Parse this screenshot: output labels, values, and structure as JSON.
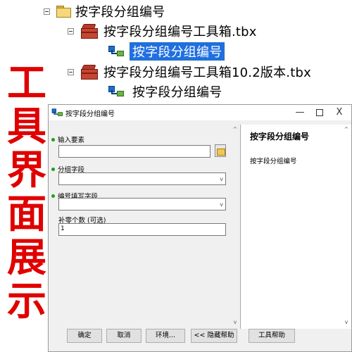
{
  "tree": {
    "folder_label": "按字段分组编号",
    "toolbox1_label": "按字段分组编号工具箱.tbx",
    "tool1_label": "按字段分组编号",
    "toolbox2_label": "按字段分组编号工具箱10.2版本.tbx",
    "tool2_label": "按字段分组编号"
  },
  "banner": {
    "text": "工具界面展示",
    "color": "#e00000"
  },
  "dialog": {
    "title": "按字段分组编号",
    "controls": {
      "minimize": "—",
      "close": "X"
    },
    "params": {
      "input_features_label": "输入要素",
      "group_field_label": "分组字段",
      "number_field_label": "编号填写字段",
      "pad_zeros_label": "补零个数 (可选)",
      "pad_zeros_value": "1"
    },
    "help": {
      "title": "按字段分组编号",
      "text": "按字段分组编号"
    },
    "buttons": {
      "ok": "确定",
      "cancel": "取消",
      "env": "环境...",
      "hide_help": "<< 隐藏帮助",
      "tool_help": "工具帮助"
    },
    "scroll": {
      "up": "^",
      "down": "v"
    },
    "select_arrow": "v"
  },
  "colors": {
    "selection": "#1f6fe0",
    "required_dot": "#1aa11a"
  }
}
